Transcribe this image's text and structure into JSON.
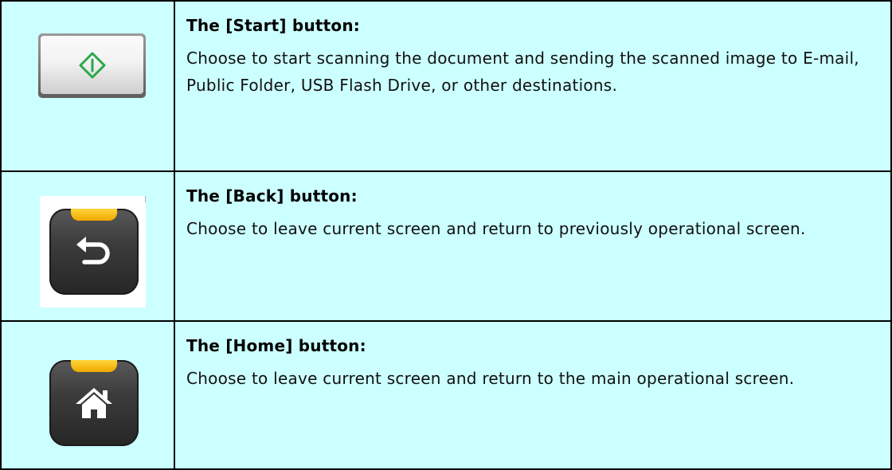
{
  "rows": [
    {
      "icon": "start-diamond-icon",
      "title": "The [Start] button:",
      "description": "Choose to start scanning the document and sending the scanned image to E-mail, Public Folder, USB Flash Drive, or other destinations."
    },
    {
      "icon": "back-arrow-icon",
      "title": "The [Back] button:",
      "description": "Choose to leave current screen and return to previously operational screen."
    },
    {
      "icon": "home-icon",
      "title": "The [Home] button:",
      "description": "Choose to leave current screen and return to the main operational screen."
    }
  ],
  "colors": {
    "cell_background": "#ccffff",
    "border": "#000000",
    "start_glyph": "#2aa84a",
    "tab_yellow": "#f6c21a"
  }
}
